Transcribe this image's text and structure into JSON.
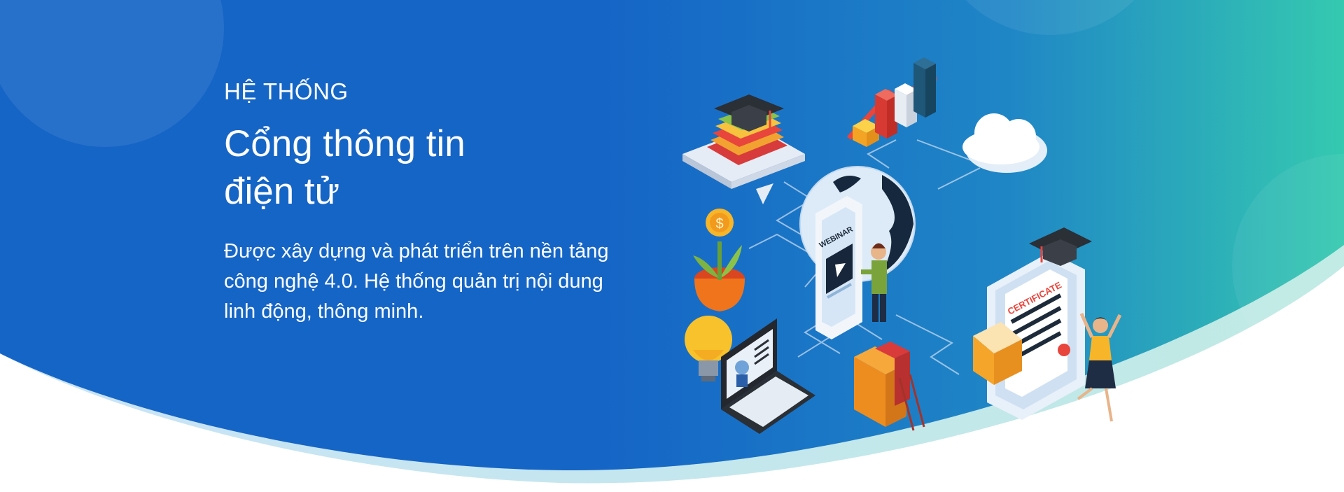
{
  "hero": {
    "eyebrow": "HỆ THỐNG",
    "title_lines": [
      "Cổng thông tin",
      "điện tử"
    ],
    "description_lines": [
      "Được xây dựng và phát triển trên nền tảng",
      "công nghệ 4.0. Hệ thống quản trị nội dung",
      "linh động, thông minh."
    ]
  },
  "illustration": {
    "webinar_label": "WEBINAR",
    "certificate_label": "CERTIFICATE"
  },
  "colors": {
    "primary_blue": "#1565c6",
    "teal": "#33c8b0",
    "light_teal": "#bfe8e6",
    "white": "#ffffff"
  }
}
